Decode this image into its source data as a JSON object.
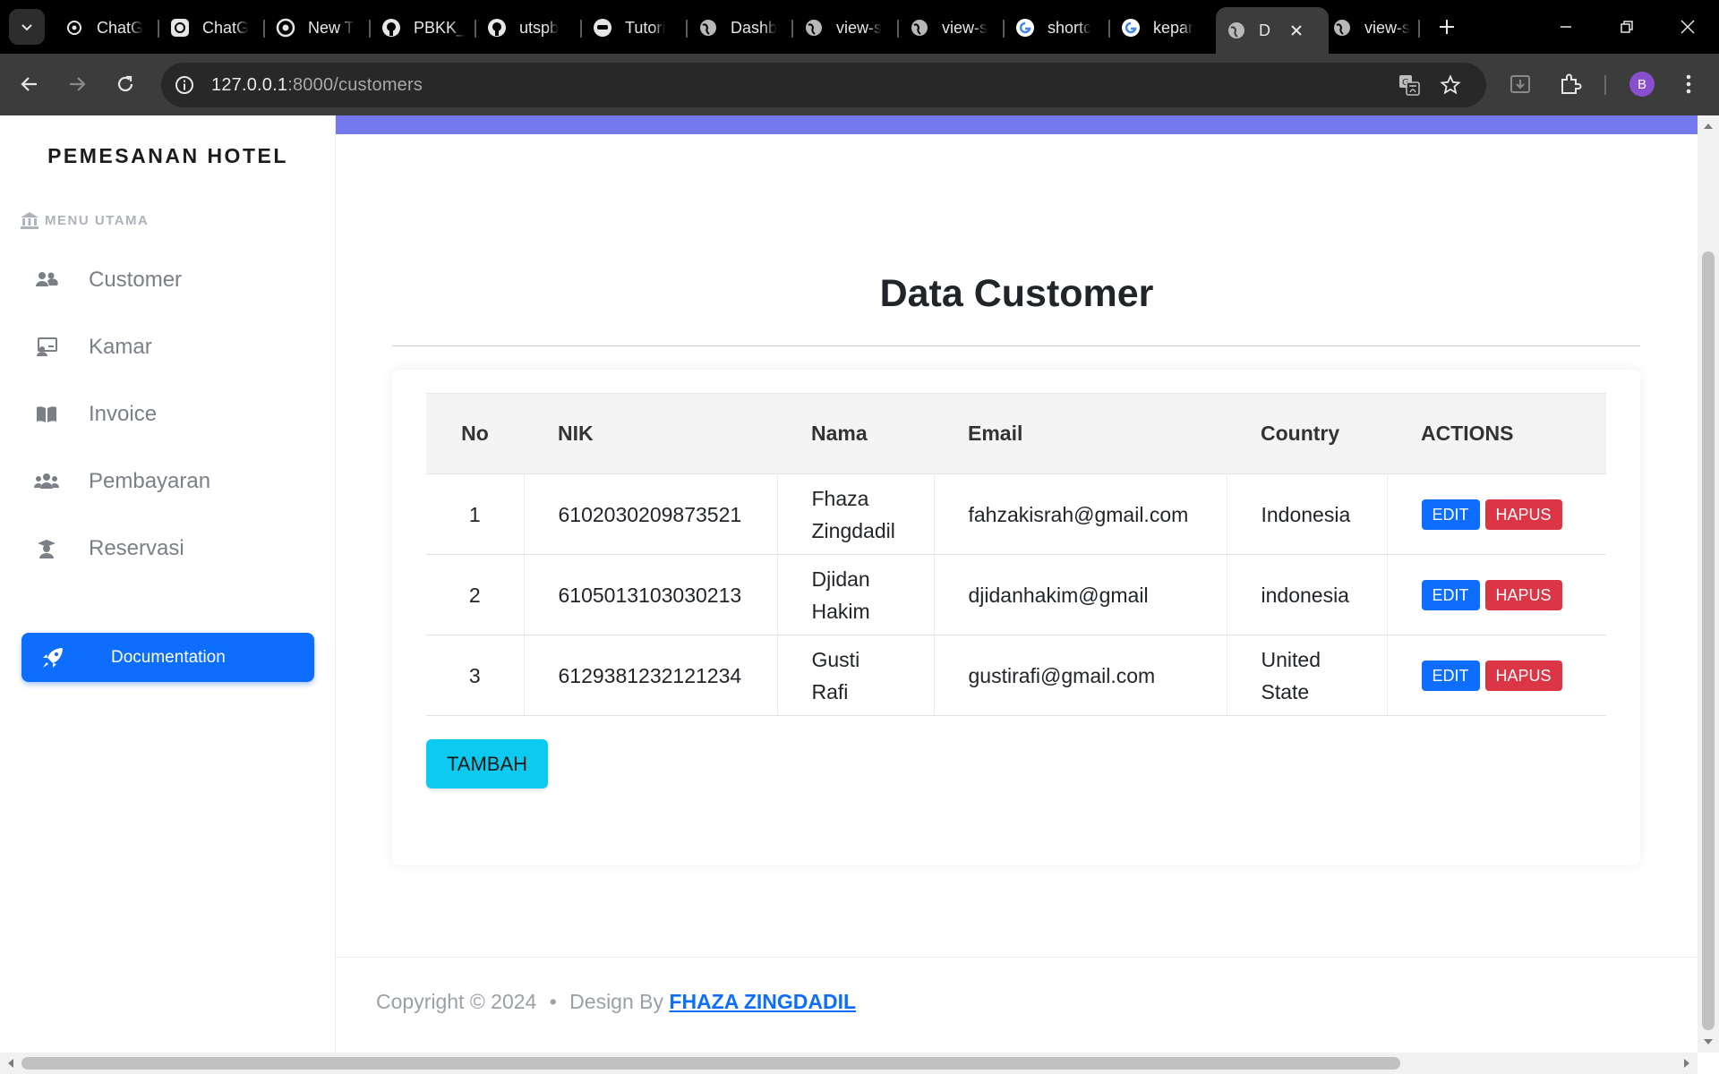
{
  "browser": {
    "tabs": [
      {
        "label": "ChatG",
        "icon": "openai-icon"
      },
      {
        "label": "ChatG",
        "icon": "openai-icon"
      },
      {
        "label": "New T",
        "icon": "chrome-icon"
      },
      {
        "label": "PBKK_",
        "icon": "github-icon"
      },
      {
        "label": "utspb",
        "icon": "github-icon"
      },
      {
        "label": "Tutori",
        "icon": "tutorial-icon"
      },
      {
        "label": "Dashb",
        "icon": "globe-icon"
      },
      {
        "label": "view-s",
        "icon": "globe-icon"
      },
      {
        "label": "view-s",
        "icon": "globe-icon"
      },
      {
        "label": "shortc",
        "icon": "google-icon"
      },
      {
        "label": "kepar",
        "icon": "google-icon"
      },
      {
        "label": "D",
        "icon": "globe-icon",
        "active": true
      },
      {
        "label": "view-s",
        "icon": "globe-icon"
      }
    ],
    "url_host": "127.0.0.1",
    "url_rest": ":8000/customers",
    "profile_initial": "B"
  },
  "sidebar": {
    "brand": "PEMESANAN HOTEL",
    "menu_heading": "MENU UTAMA",
    "items": [
      {
        "label": "Customer",
        "icon": "users-icon"
      },
      {
        "label": "Kamar",
        "icon": "room-card-icon"
      },
      {
        "label": "Invoice",
        "icon": "book-icon"
      },
      {
        "label": "Pembayaran",
        "icon": "group-icon"
      },
      {
        "label": "Reservasi",
        "icon": "graduate-icon"
      }
    ],
    "doc_button": "Documentation"
  },
  "main": {
    "title": "Data Customer",
    "table": {
      "headers": [
        "No",
        "NIK",
        "Nama",
        "Email",
        "Country",
        "ACTIONS"
      ],
      "rows": [
        {
          "no": "1",
          "nik": "6102030209873521",
          "nama_1": "Fhaza",
          "nama_2": "Zingdadil",
          "email": "fahzakisrah@gmail.com",
          "country_1": "Indonesia",
          "country_2": ""
        },
        {
          "no": "2",
          "nik": "6105013103030213",
          "nama_1": "Djidan",
          "nama_2": "Hakim",
          "email": "djidanhakim@gmail",
          "country_1": "indonesia",
          "country_2": ""
        },
        {
          "no": "3",
          "nik": "6129381232121234",
          "nama_1": "Gusti",
          "nama_2": "Rafi",
          "email": "gustirafi@gmail.com",
          "country_1": "United",
          "country_2": "State"
        }
      ],
      "edit_label": "EDIT",
      "delete_label": "HAPUS"
    },
    "add_button": "TAMBAH"
  },
  "footer": {
    "copyright": "Copyright © 2024",
    "separator": "•",
    "design_by": "Design By",
    "author": "FHAZA ZINGDADIL"
  },
  "colors": {
    "accent_strip": "#7479ee",
    "primary": "#0d6efd",
    "danger": "#dc3545",
    "info": "#0dcaf0"
  }
}
